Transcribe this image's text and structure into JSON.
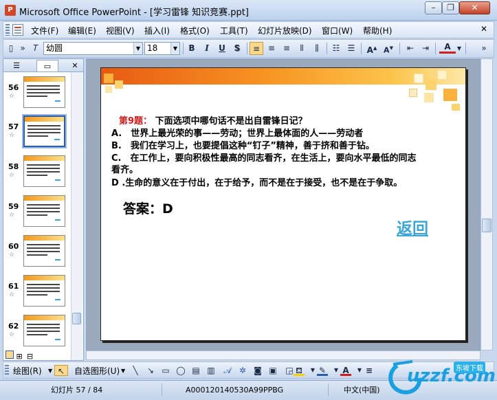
{
  "window": {
    "title": "Microsoft Office PowerPoint - [学习雷锋 知识竞赛.ppt]",
    "app_icon": "P",
    "minimize": "–",
    "restore": "❐",
    "close": "✕"
  },
  "menubar": {
    "items": [
      "文件(F)",
      "编辑(E)",
      "视图(V)",
      "插入(I)",
      "格式(O)",
      "工具(T)",
      "幻灯片放映(D)",
      "窗口(W)",
      "帮助(H)"
    ],
    "close_doc": "✕"
  },
  "toolbar": {
    "font_name": "幼圆",
    "font_size": "18",
    "bold": "B",
    "italic": "I",
    "underline": "U",
    "shadow": "S",
    "font_color_label": "A",
    "grow_font": "A",
    "shrink_font": "A"
  },
  "left_panel": {
    "tab_outline_icon": "outline-icon",
    "tab_slides_icon": "slides-icon",
    "close": "✕",
    "thumbnails": [
      {
        "num": "56",
        "star": "☆"
      },
      {
        "num": "57",
        "star": "☆"
      },
      {
        "num": "58",
        "star": "☆"
      },
      {
        "num": "59",
        "star": "☆"
      },
      {
        "num": "60",
        "star": "☆"
      },
      {
        "num": "61",
        "star": "☆"
      },
      {
        "num": "62",
        "star": "☆"
      }
    ]
  },
  "slide": {
    "q_num": "第9题：",
    "question": "下面选项中哪句话不是出自雷锋日记？",
    "options": [
      "A.　世界上最光荣的事——劳动；世界上最体面的人——劳动者",
      "B.　我们在学习上，也要提倡这种“钉子”精神，善于挤和善于钻。",
      "C.　在工作上，要向积极性最高的同志看齐，在生活上，要向水平最低的同志",
      "看齐。",
      "D .生命的意义在于付出，在于给予，而不是在于接受，也不是在于争取。"
    ],
    "answer": "答案：D",
    "return_link": "返回"
  },
  "drawbar": {
    "draw": "绘图(R)",
    "autoshapes": "自选图形(U)",
    "font_color_label": "A"
  },
  "statusbar": {
    "slide_info": "幻灯片 57 / 84",
    "template": "A000120140530A99PPBG",
    "language": "中文(中国)"
  },
  "watermark": {
    "brand": "uzzf.com",
    "tagline": "东坡下载"
  },
  "colors": {
    "accent_orange": "#f79422",
    "question_red": "#d21b1b",
    "link_blue": "#3aa6d8"
  }
}
